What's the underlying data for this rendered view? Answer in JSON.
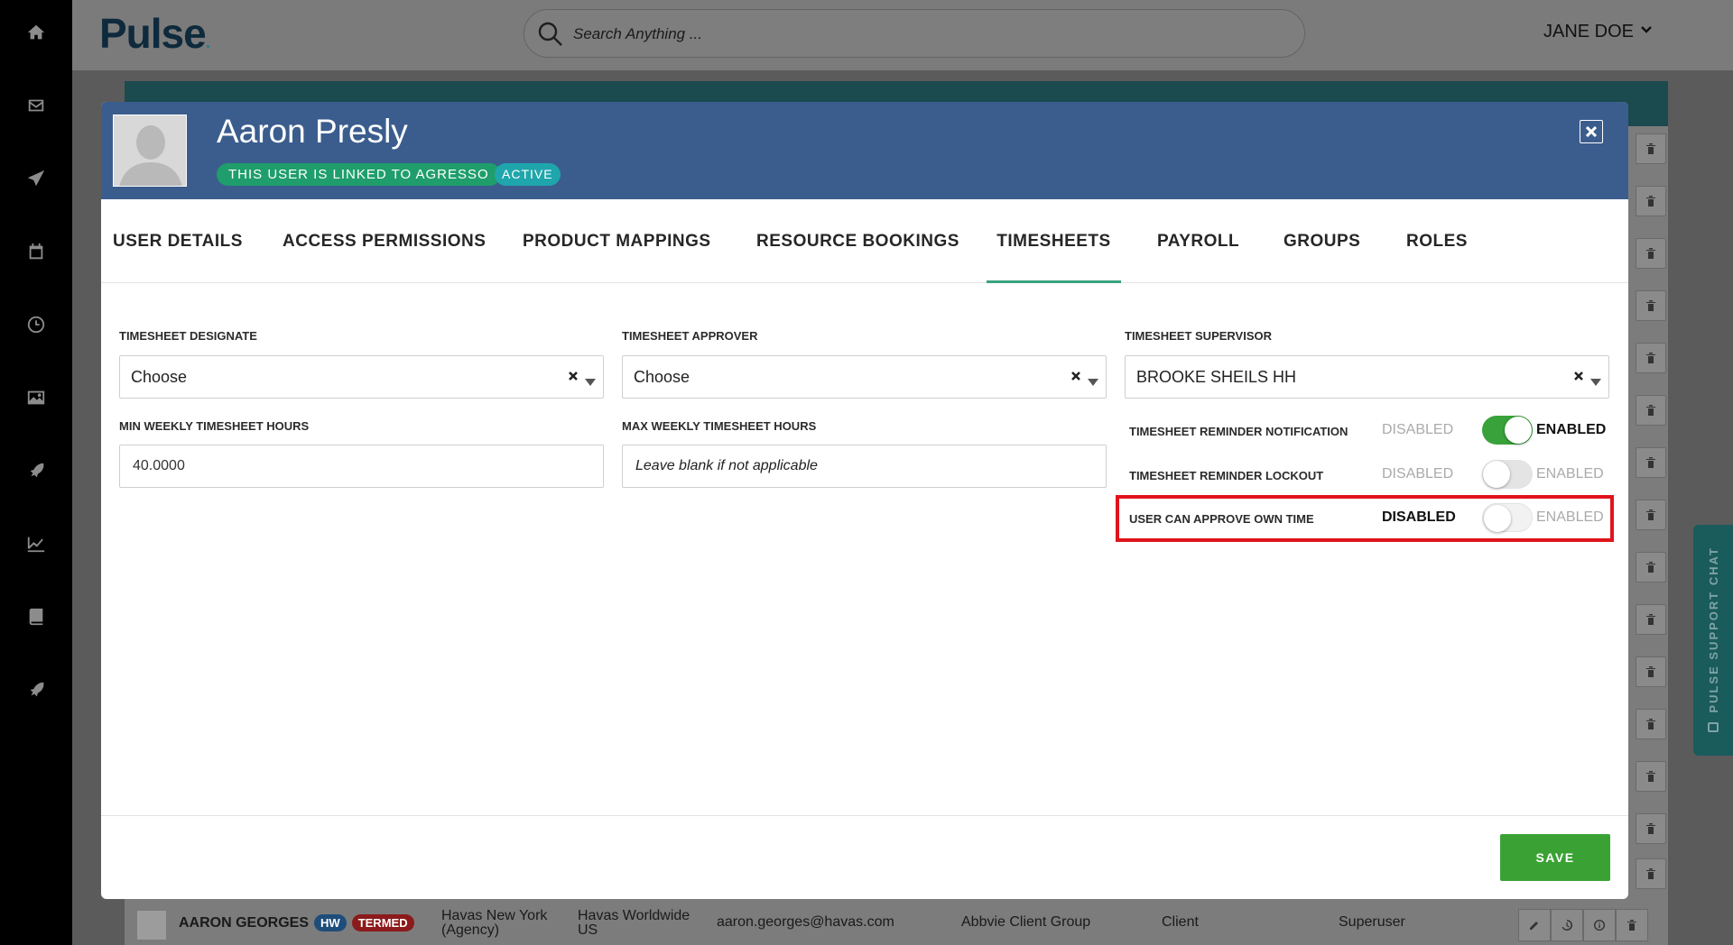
{
  "app": {
    "logo": "Pulse",
    "search_placeholder": "Search Anything ...",
    "user_menu_label": "JANE DOE",
    "support_chat_label": "PULSE SUPPORT CHAT"
  },
  "side_nav": [
    "home-icon",
    "mail-icon",
    "send-icon",
    "calendar-icon",
    "clock-icon",
    "image-icon",
    "rocket-icon",
    "chart-line-icon",
    "book-icon",
    "rocket-icon"
  ],
  "background_row": {
    "name": "AARON GEORGES",
    "badge_hw": "HW",
    "badge_termed": "TERMED",
    "office_line1": "Havas New York",
    "office_line2": "(Agency)",
    "network_line1": "Havas Worldwide",
    "network_line2": "US",
    "email": "aaron.georges@havas.com",
    "user_group": "Abbvie Client Group",
    "user_category": "Client",
    "access": "Superuser"
  },
  "modal": {
    "user_name": "Aaron Presly",
    "badge_linked": "THIS USER IS LINKED TO AGRESSO",
    "badge_status": "ACTIVE",
    "tabs": [
      {
        "label": "USER DETAILS",
        "active": false
      },
      {
        "label": "ACCESS PERMISSIONS",
        "active": false
      },
      {
        "label": "PRODUCT MAPPINGS",
        "active": false
      },
      {
        "label": "RESOURCE BOOKINGS",
        "active": false
      },
      {
        "label": "TIMESHEETS",
        "active": true
      },
      {
        "label": "PAYROLL",
        "active": false
      },
      {
        "label": "GROUPS",
        "active": false
      },
      {
        "label": "ROLES",
        "active": false
      }
    ],
    "fields": {
      "designate": {
        "label": "TIMESHEET DESIGNATE",
        "value": "Choose"
      },
      "approver": {
        "label": "TIMESHEET APPROVER",
        "value": "Choose"
      },
      "supervisor": {
        "label": "TIMESHEET SUPERVISOR",
        "value": "BROOKE SHEILS HH"
      },
      "min_hours": {
        "label": "MIN WEEKLY TIMESHEET HOURS",
        "value": "40.0000"
      },
      "max_hours": {
        "label": "MAX WEEKLY TIMESHEET HOURS",
        "placeholder": "Leave blank if not applicable"
      }
    },
    "toggles": [
      {
        "label": "TIMESHEET REMINDER NOTIFICATION",
        "off_label": "DISABLED",
        "on_label": "ENABLED",
        "enabled": true
      },
      {
        "label": "TIMESHEET REMINDER LOCKOUT",
        "off_label": "DISABLED",
        "on_label": "ENABLED",
        "enabled": false
      },
      {
        "label": "USER CAN APPROVE OWN TIME",
        "off_label": "DISABLED",
        "on_label": "ENABLED",
        "enabled": false
      }
    ],
    "save_label": "SAVE"
  },
  "colors": {
    "header_blue": "#3b5d8e",
    "accent_green": "#3aa234",
    "highlight_red": "#e0141c",
    "badge_linked": "#1f9e6b",
    "badge_active": "#1fa6ac"
  }
}
